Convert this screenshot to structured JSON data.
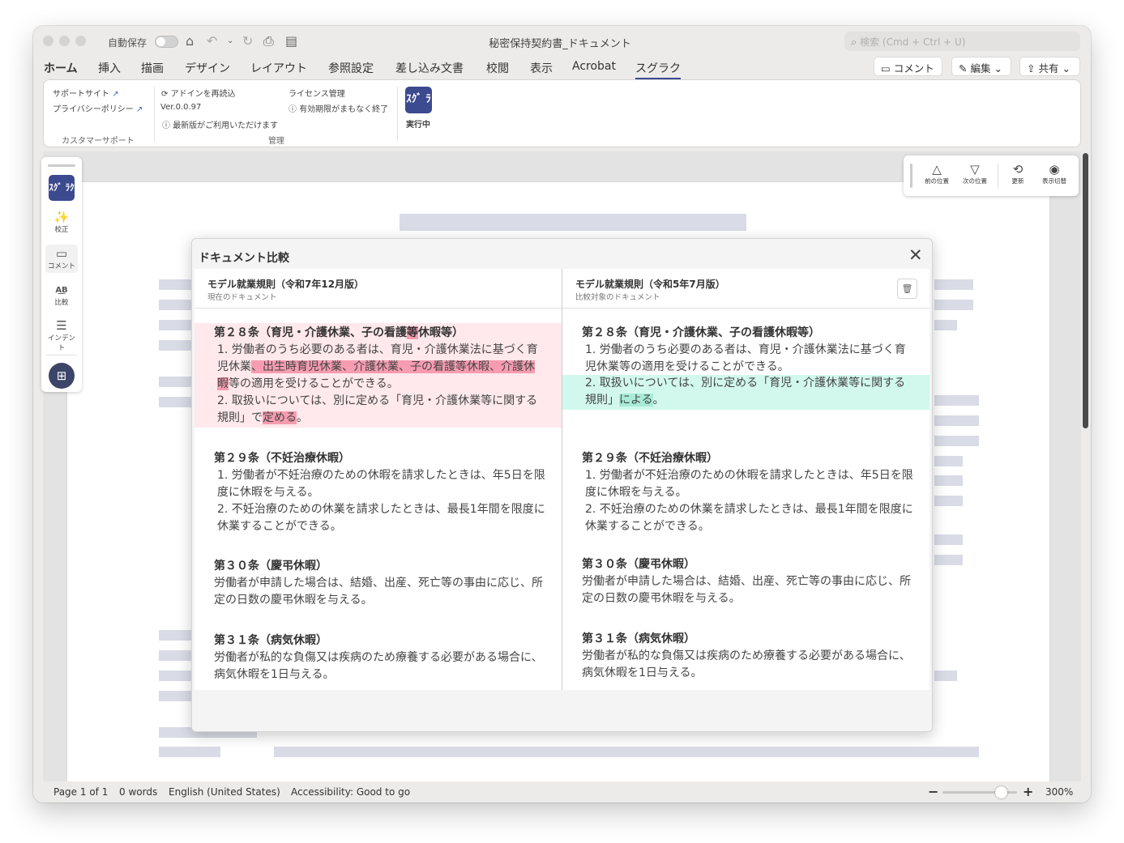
{
  "window": {
    "title": "秘密保持契約書_ドキュメント",
    "autosave_label": "自動保存",
    "search_placeholder": "検索 (Cmd + Ctrl + U)"
  },
  "menu": {
    "items": [
      "ホーム",
      "挿入",
      "描画",
      "デザイン",
      "レイアウト",
      "参照設定",
      "差し込み文書",
      "校閲",
      "表示",
      "Acrobat",
      "スグラク"
    ],
    "active": "スグラク",
    "comment_btn": "コメント",
    "edit_btn": "編集",
    "share_btn": "共有"
  },
  "ribbon": {
    "support_site": "サポートサイト",
    "privacy_policy": "プライバシーポリシー",
    "customer_support": "カスタマーサポート",
    "reload_addin": "アドインを再読込",
    "license_mgmt": "ライセンス管理",
    "version": "Ver.0.0.97",
    "expiry_notice": "有効期限がまもなく終了",
    "update_notice": "最新版がご利用いただけます",
    "management": "管理",
    "running": "実行中",
    "logo_text": "ｽｸﾞ ﾗｸ"
  },
  "sidebar": {
    "logo": "ｽｸﾞ ﾗｸ",
    "items": [
      {
        "label": "校正",
        "icon": "proofread-icon"
      },
      {
        "label": "コメント",
        "icon": "comment-icon"
      },
      {
        "label": "比較",
        "icon": "compare-icon"
      },
      {
        "label": "インデント",
        "icon": "indent-icon"
      }
    ]
  },
  "compare_toolbar": {
    "prev": "前の位置",
    "next": "次の位置",
    "refresh": "更新",
    "toggle": "表示切替"
  },
  "modal": {
    "title": "ドキュメント比較",
    "left": {
      "doc_title": "モデル就業規則（令和7年12月版）",
      "doc_sub": "現在のドキュメント",
      "a28": {
        "h_pre": "第２８条（育児・介護休業、子の看護",
        "h_mark": "等",
        "h_post": "休暇等）",
        "p1_pre": "1. 労働者のうち必要のある者は、育児・介護休業法に基づく育児休業",
        "p1_mark1": "、出生時育児休業、介護休業、子の看護等休暇、介",
        "p1_mark2": "護休暇",
        "p1_post": "等の適用を受けることができる。",
        "p2_pre": "2. 取扱いについては、別に定める「育児・介護休業等に関する規則」で",
        "p2_mark": "定める",
        "p2_post": "。"
      },
      "a29": {
        "h": "第２９条（不妊治療休暇）",
        "p1": "1. 労働者が不妊治療のための休暇を請求したときは、年5日を限度に休暇を与える。",
        "p2": "2. 不妊治療のための休業を請求したときは、最長1年間を限度に休業することができる。"
      },
      "a30": {
        "h": "第３０条（慶弔休暇）",
        "p": "労働者が申請した場合は、結婚、出産、死亡等の事由に応じ、所定の日数の慶弔休暇を与える。"
      },
      "a31": {
        "h": "第３１条（病気休暇）",
        "p": "労働者が私的な負傷又は疾病のため療養する必要がある場合に、病気休暇を1日与える。"
      }
    },
    "right": {
      "doc_title": "モデル就業規則（令和5年7月版）",
      "doc_sub": "比較対象のドキュメント",
      "a28": {
        "h": "第２８条（育児・介護休業、子の看護休暇等）",
        "p1": "1. 労働者のうち必要のある者は、育児・介護休業法に基づく育児休業等の適用を受けることができる。",
        "p2_pre": "2. 取扱いについては、別に定める「育児・介護休業等に関する規則」",
        "p2_mark": "による",
        "p2_post": "。"
      },
      "a29": {
        "h": "第２９条（不妊治療休暇）",
        "p1": "1. 労働者が不妊治療のための休暇を請求したときは、年5日を限度に休暇を与える。",
        "p2": "2. 不妊治療のための休業を請求したときは、最長1年間を限度に休業することができる。"
      },
      "a30": {
        "h": "第３０条（慶弔休暇）",
        "p": "労働者が申請した場合は、結婚、出産、死亡等の事由に応じ、所定の日数の慶弔休暇を与える。"
      },
      "a31": {
        "h": "第３１条（病気休暇）",
        "p": "労働者が私的な負傷又は疾病のため療養する必要がある場合に、病気休暇を1日与える。"
      }
    }
  },
  "status": {
    "page": "Page 1 of 1",
    "words": "0 words",
    "language": "English (United States)",
    "accessibility": "Accessibility: Good to go",
    "zoom": "300%",
    "zoom_level": 0.78
  },
  "colors": {
    "accent": "#3c4a8f",
    "deleted_bg": "#ffe9ec",
    "deleted_mark": "#f79cb1",
    "inserted_bg": "#d2f8ee",
    "inserted_mark": "#a8ecd8"
  }
}
